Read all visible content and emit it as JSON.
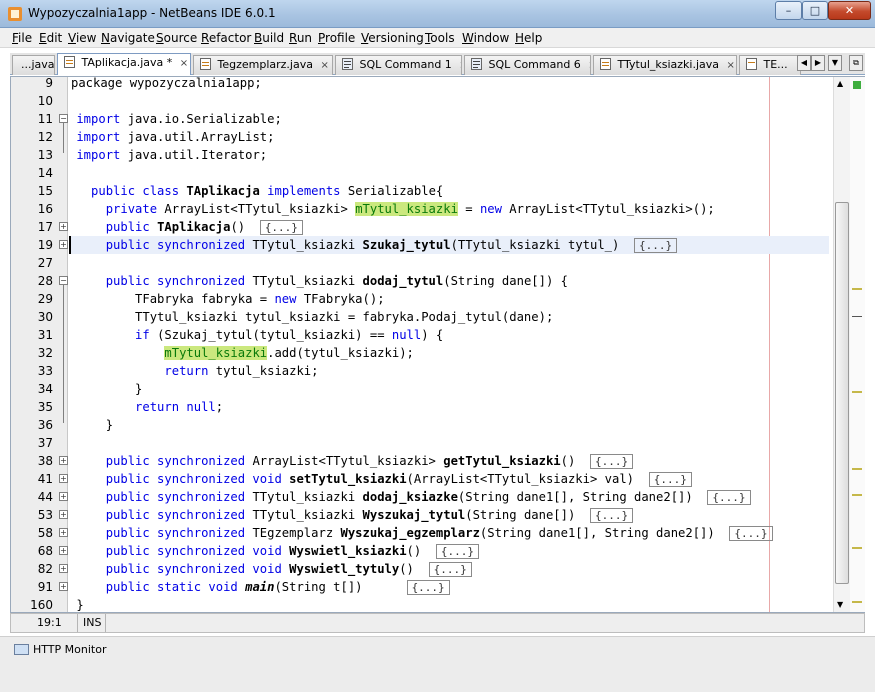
{
  "window": {
    "title": "Wypozyczalnia1app - NetBeans IDE 6.0.1",
    "min": "–",
    "max": "□",
    "close": "✕"
  },
  "menu": [
    "File",
    "Edit",
    "View",
    "Navigate",
    "Source",
    "Refactor",
    "Build",
    "Run",
    "Profile",
    "Versioning",
    "Tools",
    "Window",
    "Help"
  ],
  "tabs": [
    {
      "label": "...java",
      "active": false
    },
    {
      "label": "TAplikacja.java *",
      "active": true
    },
    {
      "label": "Tegzemplarz.java",
      "active": false
    },
    {
      "label": "SQL Command 1",
      "active": false
    },
    {
      "label": "SQL Command 6",
      "active": false
    },
    {
      "label": "TTytul_ksiazki.java",
      "active": false
    },
    {
      "label": "TE...",
      "active": false
    }
  ],
  "tab_close": "×",
  "line_numbers": [
    "9",
    "10",
    "11",
    "12",
    "13",
    "14",
    "15",
    "16",
    "17",
    "19",
    "27",
    "28",
    "29",
    "30",
    "31",
    "32",
    "33",
    "34",
    "35",
    "36",
    "37",
    "38",
    "41",
    "44",
    "53",
    "58",
    "68",
    "82",
    "91",
    "160"
  ],
  "code": {
    "l9": "package wypozyczalnia1app;",
    "l11_kw": "import",
    "l11": " java.io.Serializable;",
    "l12_kw": "import",
    "l12": " java.util.ArrayList;",
    "l13_kw": "import",
    "l13": " java.util.Iterator;",
    "l15_kw1": "public class",
    "l15_name": "TAplikacja",
    "l15_kw2": "implements",
    "l15_rest": " Serializable{",
    "l16_kw": "private",
    "l16_type": " ArrayList<TTytul_ksiazki> ",
    "l16_field": "mTytul_ksiazki",
    "l16_eq": " = ",
    "l16_new": "new",
    "l16_rest": " ArrayList<TTytul_ksiazki>();",
    "l17_kw": "public",
    "l17_name": "TAplikacja",
    "l17_rest": "()",
    "l19_kw": "public synchronized",
    "l19_type": " TTytul_ksiazki ",
    "l19_name": "Szukaj_tytul",
    "l19_rest": "(TTytul_ksiazki tytul_)",
    "l28_kw": "public synchronized",
    "l28_type": " TTytul_ksiazki ",
    "l28_name": "dodaj_tytul",
    "l28_rest": "(String dane[]) {",
    "l29_a": "TFabryka fabryka = ",
    "l29_new": "new",
    "l29_b": " TFabryka();",
    "l30": "TTytul_ksiazki tytul_ksiazki = fabryka.Podaj_tytul(dane);",
    "l31_if": "if",
    "l31_a": " (Szukaj_tytul(tytul_ksiazki) == ",
    "l31_null": "null",
    "l31_b": ") {",
    "l32_field": "mTytul_ksiazki",
    "l32_rest": ".add(tytul_ksiazki);",
    "l33_ret": "return",
    "l33_rest": " tytul_ksiazki;",
    "l34": "}",
    "l35_ret": "return",
    "l35_null": "null",
    "l35_end": ";",
    "l36": "}",
    "l38_kw": "public synchronized",
    "l38_type": " ArrayList<TTytul_ksiazki> ",
    "l38_name": "getTytul_ksiazki",
    "l38_rest": "()",
    "l41_kw": "public synchronized void",
    "l41_name": "setTytul_ksiazki",
    "l41_rest": "(ArrayList<TTytul_ksiazki> val)",
    "l44_kw": "public synchronized",
    "l44_type": " TTytul_ksiazki ",
    "l44_name": "dodaj_ksiazke",
    "l44_rest": "(String dane1[], String dane2[])",
    "l53_kw": "public synchronized",
    "l53_type": " TTytul_ksiazki ",
    "l53_name": "Wyszukaj_tytul",
    "l53_rest": "(String dane[])",
    "l58_kw": "public synchronized",
    "l58_type": " TEgzemplarz ",
    "l58_name": "Wyszukaj_egzemplarz",
    "l58_rest": "(String dane1[], String dane2[])",
    "l68_kw": "public synchronized void",
    "l68_name": "Wyswietl_ksiazki",
    "l68_rest": "()",
    "l82_kw": "public synchronized void",
    "l82_name": "Wyswietl_tytuly",
    "l82_rest": "()",
    "l91_kw": "public static void",
    "l91_name": "main",
    "l91_rest": "(String t[])",
    "l160": "}",
    "collapsed": "{...}"
  },
  "status": {
    "position": "19:1",
    "mode": "INS"
  },
  "bottom": {
    "http_monitor": "HTTP Monitor"
  },
  "colors": {
    "keyword": "#0000e6",
    "field_highlight": "#cbe87e",
    "field_text": "#0a7a0a"
  }
}
